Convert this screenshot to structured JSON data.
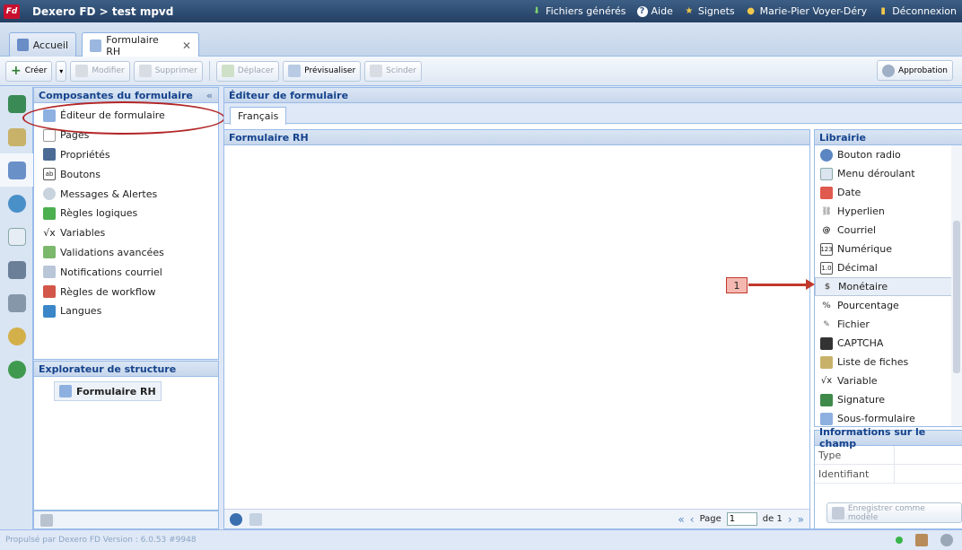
{
  "topbar": {
    "logo_text": "Fd",
    "title": "Dexero FD > test mpvd",
    "nav": [
      {
        "label": "Fichiers générés",
        "icon": "download-icon"
      },
      {
        "label": "Aide",
        "icon": "help-icon"
      },
      {
        "label": "Signets",
        "icon": "bookmark-icon"
      },
      {
        "label": "Marie-Pier Voyer-Déry",
        "icon": "user-icon"
      },
      {
        "label": "Déconnexion",
        "icon": "logout-icon"
      }
    ]
  },
  "tabs": [
    {
      "label": "Accueil",
      "icon": "home-icon"
    },
    {
      "label": "Formulaire RH",
      "icon": "form-edit-icon",
      "close": "✕"
    }
  ],
  "toolbar": {
    "create": "Créer",
    "modify": "Modifier",
    "delete": "Supprimer",
    "move": "Déplacer",
    "preview": "Prévisualiser",
    "split": "Scinder",
    "approval": "Approbation"
  },
  "components_panel": {
    "title": "Composantes du formulaire",
    "collapse": "«",
    "items": [
      "Éditeur de formulaire",
      "Pages",
      "Propriétés",
      "Boutons",
      "Messages & Alertes",
      "Règles logiques",
      "Variables",
      "Validations avancées",
      "Notifications courriel",
      "Règles de workflow",
      "Langues"
    ]
  },
  "structure_panel": {
    "title": "Explorateur de structure",
    "node": "Formulaire RH"
  },
  "editor": {
    "title": "Éditeur de formulaire",
    "lang_tab": "Français",
    "form_title": "Formulaire RH",
    "pager": {
      "page_label": "Page",
      "page_value": "1",
      "of_label": "de 1"
    }
  },
  "library": {
    "title": "Librairie",
    "items": [
      "Bouton radio",
      "Menu déroulant",
      "Date",
      "Hyperlien",
      "Courriel",
      "Numérique",
      "Décimal",
      "Monétaire",
      "Pourcentage",
      "Fichier",
      "CAPTCHA",
      "Liste de fiches",
      "Variable",
      "Signature",
      "Sous-formulaire"
    ],
    "callout": "1"
  },
  "field_info": {
    "title": "Informations sur le champ",
    "type_label": "Type",
    "id_label": "Identifiant",
    "save_button": "Enregistrer comme modèle"
  },
  "footer": {
    "text": "Propulsé par Dexero FD Version : 6.0.53 #9948"
  }
}
